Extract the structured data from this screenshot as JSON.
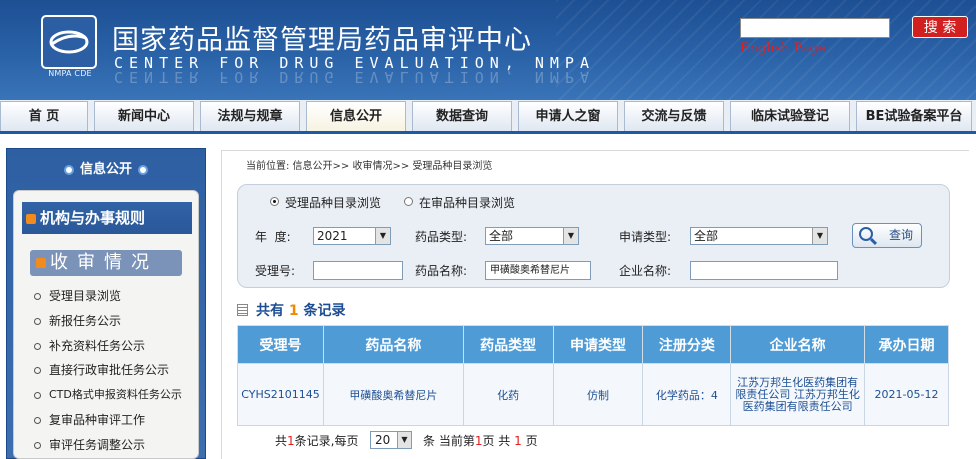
{
  "header": {
    "logo_caption": "NMPA CDE",
    "title_cn": "国家药品监督管理局药品审评中心",
    "title_en": "CENTER FOR DRUG EVALUATION, NMPA",
    "search_placeholder": "",
    "search_button": "搜 索",
    "english_link": "English Page"
  },
  "nav": {
    "tabs": [
      {
        "label": "首 页"
      },
      {
        "label": "新闻中心"
      },
      {
        "label": "法规与规章"
      },
      {
        "label": "信息公开"
      },
      {
        "label": "数据查询"
      },
      {
        "label": "申请人之窗"
      },
      {
        "label": "交流与反馈"
      },
      {
        "label": "临床试验登记"
      },
      {
        "label": "BE试验备案平台"
      }
    ]
  },
  "sidebar": {
    "title": "信息公开",
    "heading1": "机构与办事规则",
    "heading2": "收审情况",
    "items": [
      {
        "label": "受理目录浏览"
      },
      {
        "label": "新报任务公示"
      },
      {
        "label": "补充资料任务公示"
      },
      {
        "label": "直接行政审批任务公示"
      },
      {
        "label": "CTD格式申报资料任务公示"
      },
      {
        "label": "复审品种审评工作"
      },
      {
        "label": "审评任务调整公示"
      }
    ]
  },
  "breadcrumb": "当前位置: 信息公开>> 收审情况>> 受理品种目录浏览",
  "filters": {
    "radio1": "受理品种目录浏览",
    "radio2": "在审品种目录浏览",
    "year_label": "年  度:",
    "year_value": "2021",
    "drug_type_label": "药品类型:",
    "drug_type_value": "全部",
    "apply_type_label": "申请类型:",
    "apply_type_value": "全部",
    "accept_no_label": "受理号:",
    "accept_no_value": "",
    "drug_name_label": "药品名称:",
    "drug_name_value": "甲磺酸奥希替尼片",
    "company_label": "企业名称:",
    "company_value": "",
    "query_button": "查询"
  },
  "result": {
    "prefix": "共有",
    "count": "1",
    "suffix": "条记录"
  },
  "table": {
    "headers": [
      "受理号",
      "药品名称",
      "药品类型",
      "申请类型",
      "注册分类",
      "企业名称",
      "承办日期"
    ],
    "rows": [
      {
        "accept_no": "CYHS2101145",
        "drug_name": "甲磺酸奥希替尼片",
        "drug_type": "化药",
        "apply_type": "仿制",
        "reg_class": "化学药品：4",
        "company": "江苏万邦生化医药集团有限责任公司 江苏万邦生化医药集团有限责任公司",
        "date": "2021-05-12"
      }
    ]
  },
  "pager": {
    "text1a": "共",
    "total": "1",
    "text1b": "条记录,每页",
    "page_size": "20",
    "text2a": "条 当前第",
    "current": "1",
    "text2b": "页 共",
    "pages": "1",
    "text2c": "页"
  }
}
